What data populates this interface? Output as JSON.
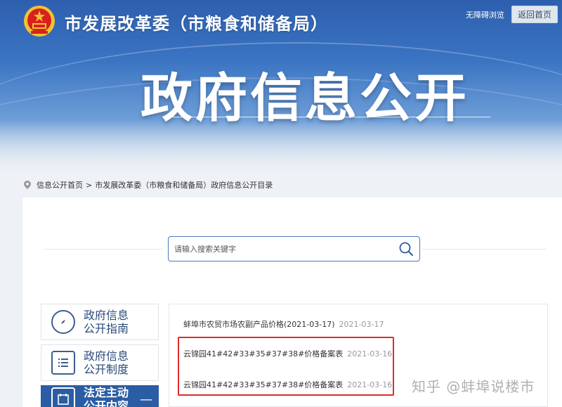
{
  "header": {
    "site_title": "市发展改革委（市粮食和储备局）",
    "main_title": "政府信息公开",
    "accessibility_link": "无障碍浏览",
    "back_home": "返回首页"
  },
  "breadcrumb": {
    "home": "信息公开首页",
    "separator": ">",
    "current": "市发展改革委（市粮食和储备局）政府信息公开目录"
  },
  "search": {
    "placeholder": "请输入搜索关键字"
  },
  "sidebar": {
    "items": [
      {
        "label": "政府信息公开指南",
        "icon": "compass-icon"
      },
      {
        "label": "政府信息公开制度",
        "icon": "document-list-icon"
      },
      {
        "label": "法定主动公开内容",
        "icon": "calendar-icon",
        "toggle": "—"
      }
    ]
  },
  "documents": [
    {
      "title": "蚌埠市农贸市场农副产品价格(2021-03-17)",
      "date": "2021-03-17"
    },
    {
      "title": "云锦园41#42#33#35#37#38#价格备案表",
      "date": "2021-03-16"
    },
    {
      "title": "云锦园41#42#33#35#37#38#价格备案表",
      "date": "2021-03-16"
    }
  ],
  "watermark": "知乎 @蚌埠说楼市",
  "colors": {
    "banner": "#3a74c2",
    "accent": "#2b5da4",
    "highlight": "#e02b2b"
  }
}
